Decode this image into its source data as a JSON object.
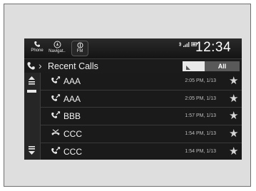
{
  "topbar": {
    "buttons": [
      {
        "label": "Phone",
        "icon": "phone-icon"
      },
      {
        "label": "Navigat..",
        "icon": "compass-icon"
      },
      {
        "label": "FM",
        "icon": "radio-icon"
      }
    ],
    "clock": "12:34"
  },
  "header": {
    "title": "Recent Calls",
    "filter_label": "All"
  },
  "calls": [
    {
      "name": "AAA",
      "time": "2:05 PM, 1/13",
      "type": "outgoing"
    },
    {
      "name": "AAA",
      "time": "2:05 PM, 1/13",
      "type": "outgoing"
    },
    {
      "name": "BBB",
      "time": "1:57 PM, 1/13",
      "type": "outgoing"
    },
    {
      "name": "CCC",
      "time": "1:54 PM, 1/13",
      "type": "missed"
    },
    {
      "name": "CCC",
      "time": "1:54 PM, 1/13",
      "type": "outgoing"
    }
  ],
  "colors": {
    "screen_bg": "#1a1a1a",
    "text": "#f2f2f2",
    "filter_active": "#595959"
  }
}
